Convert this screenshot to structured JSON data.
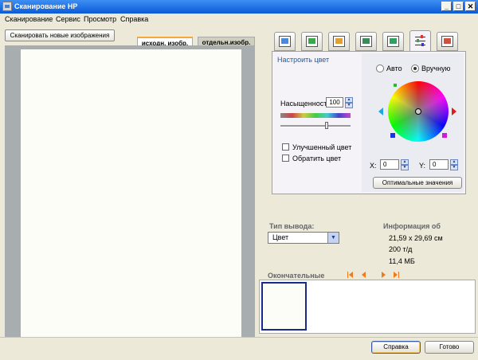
{
  "window": {
    "title": "Сканирование HP",
    "minimize": "_",
    "maximize": "□",
    "close": "✕"
  },
  "menu": [
    "Сканирование",
    "Сервис",
    "Просмотр",
    "Справка"
  ],
  "toolbar": {
    "scan_new_label": "Сканировать новые изображения"
  },
  "preview_tabs": [
    {
      "label": "исходн. изобр.",
      "active": true
    },
    {
      "label": "отдельн.изобр.",
      "active": false
    }
  ],
  "tool_tabs": [
    {
      "icon": "picture-icon"
    },
    {
      "icon": "rotate-icon"
    },
    {
      "icon": "crop-icon"
    },
    {
      "icon": "resize-icon"
    },
    {
      "icon": "auto-adjust-icon"
    },
    {
      "icon": "color-adjust-icon",
      "active": true
    },
    {
      "icon": "sharpen-icon"
    }
  ],
  "color_panel": {
    "title": "Настроить цвет",
    "mode_auto": "Авто",
    "mode_manual": "Вручную",
    "selected_mode": "Вручную",
    "saturation_label": "Насыщенност",
    "saturation_value": "100",
    "enhanced_color_label": "Улучшенный цвет",
    "invert_color_label": "Обратить цвет",
    "x_label": "X:",
    "x_value": "0",
    "y_label": "Y:",
    "y_value": "0",
    "optimal_button": "Оптимальные значения"
  },
  "output": {
    "type_label": "Тип вывода:",
    "type_value": "Цвет"
  },
  "info": {
    "label": "Информация об",
    "size": "21,59 x 29,69 см",
    "dpi": "200 т/д",
    "filesize": "11,4 МБ"
  },
  "final": {
    "label": "Окончательные"
  },
  "buttons": {
    "help": "Справка",
    "done": "Готово"
  },
  "colors": {
    "accent_title": "#0a5ad8",
    "nav_arrows": "#f07a1a",
    "panel_bg": "#f6f3f8"
  }
}
